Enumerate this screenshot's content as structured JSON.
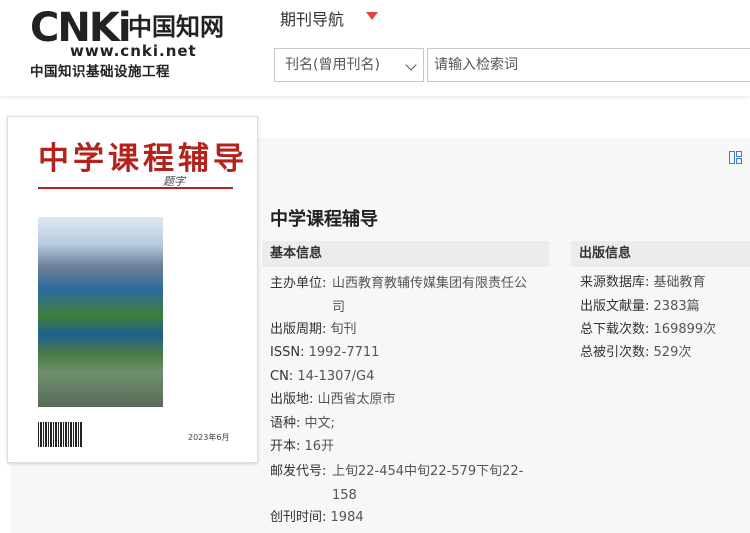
{
  "logo": {
    "brand": "CNKi",
    "cn_name": "中国知网",
    "url": "www.cnki.net",
    "subtitle": "中国知识基础设施工程"
  },
  "nav": {
    "label": "期刊导航"
  },
  "search": {
    "field_selected": "刊名(曾用刊名)",
    "placeholder": "请输入检索词"
  },
  "cover": {
    "title": "中学课程辅导",
    "signature": "题字",
    "date": "2023年6月"
  },
  "journal": {
    "title": "中学课程辅导"
  },
  "basic_info": {
    "heading": "基本信息",
    "sponsor_label": "主办单位:",
    "sponsor_value": "山西教育教辅传媒集团有限责任公司",
    "period_label": "出版周期:",
    "period_value": "旬刊",
    "issn_label": "ISSN:",
    "issn_value": "1992-7711",
    "cn_label": "CN:",
    "cn_value": "14-1307/G4",
    "place_label": "出版地:",
    "place_value": "山西省太原市",
    "lang_label": "语种:",
    "lang_value": "中文;",
    "format_label": "开本:",
    "format_value": "16开",
    "postal_label": "邮发代号:",
    "postal_value": "上旬22-454中旬22-579下旬22-158",
    "founded_label": "创刊时间:",
    "founded_value": "1984"
  },
  "pub_info": {
    "heading": "出版信息",
    "source_label": "来源数据库:",
    "source_value": "基础教育",
    "docs_label": "出版文献量:",
    "docs_value": "2383篇",
    "downloads_label": "总下载次数:",
    "downloads_value": "169899次",
    "cited_label": "总被引次数:",
    "cited_value": "529次"
  },
  "colors": {
    "accent_red": "#e1473d",
    "cover_red": "#b3231b",
    "icon_blue": "#3b7ddd"
  }
}
